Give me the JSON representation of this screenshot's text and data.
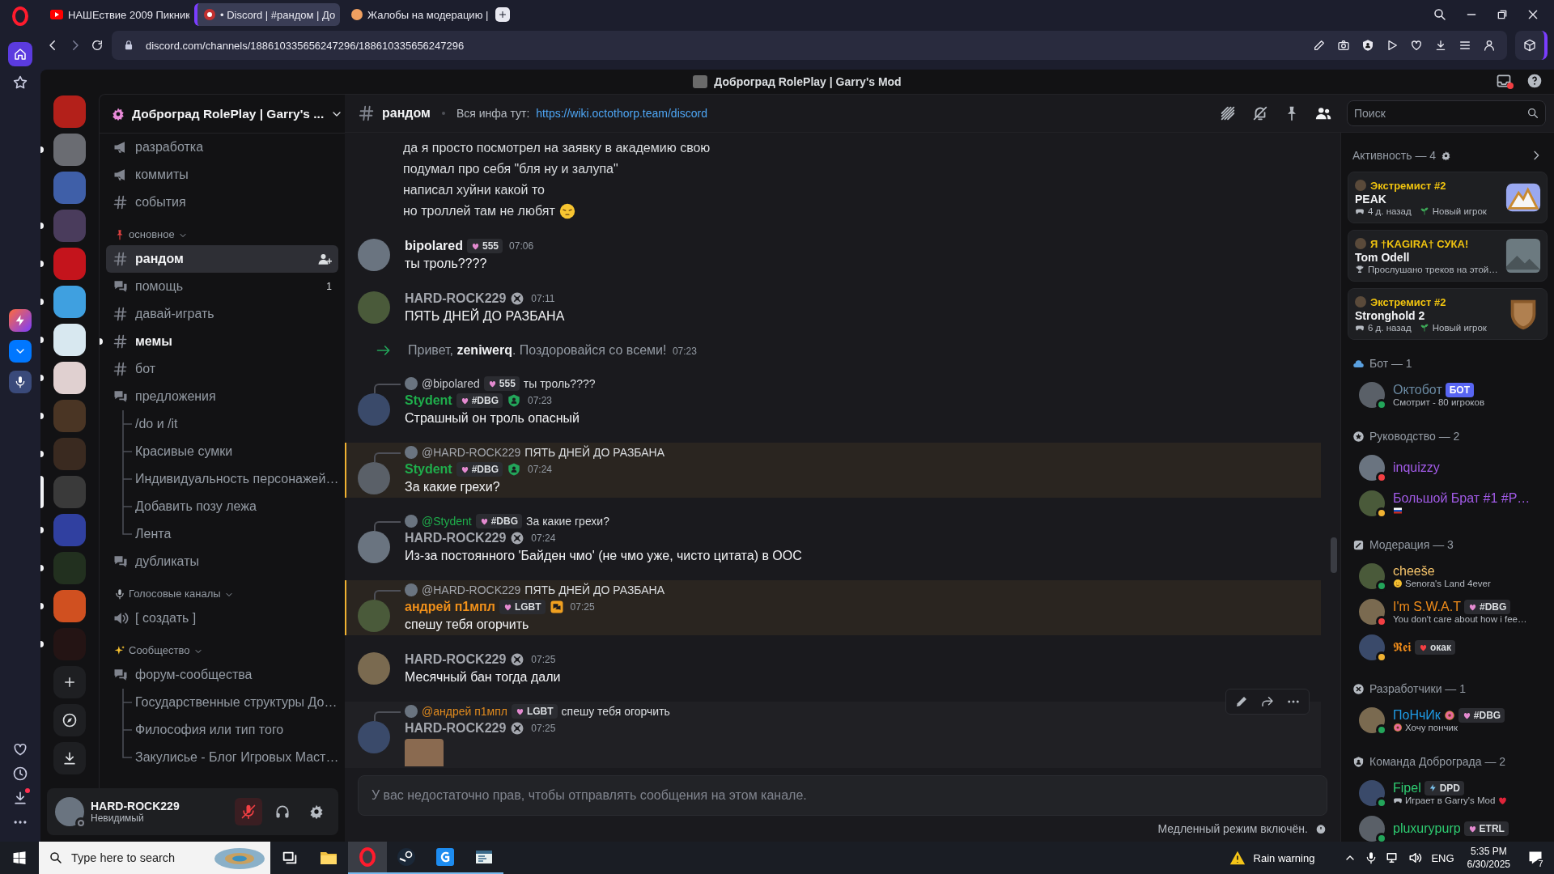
{
  "browser": {
    "tabs": [
      {
        "title": "НАШЕствие 2009 Пикник",
        "kind": "video",
        "selected": false
      },
      {
        "title": "• Discord | #рандом | До",
        "kind": "discord",
        "selected": true
      },
      {
        "title": "Жалобы на модерацию |",
        "kind": "forum",
        "selected": false
      }
    ],
    "url": "discord.com/channels/188610335656247296/188610335656247296"
  },
  "app_title": "Доброград RolePlay | Garry's Mod",
  "servers": [
    {
      "selected": false,
      "unread": false
    },
    {
      "selected": false,
      "unread": true
    },
    {
      "selected": false,
      "unread": false
    },
    {
      "selected": false,
      "unread": true
    },
    {
      "selected": false,
      "unread": true
    },
    {
      "selected": false,
      "unread": true
    },
    {
      "selected": false,
      "unread": true
    },
    {
      "selected": false,
      "unread": true
    },
    {
      "selected": false,
      "unread": true
    },
    {
      "selected": false,
      "unread": true
    },
    {
      "selected": true,
      "unread": true
    },
    {
      "selected": false,
      "unread": true
    },
    {
      "selected": false,
      "unread": true
    },
    {
      "selected": false,
      "unread": true
    },
    {
      "selected": false,
      "unread": true
    }
  ],
  "server_name": "Доброград RolePlay | Garry's ...",
  "channel_sections": [
    {
      "channels": [
        {
          "name": "разработка",
          "kind": "announcement",
          "selected": false,
          "unread": false
        },
        {
          "name": "коммиты",
          "kind": "announcement",
          "selected": false,
          "unread": false
        },
        {
          "name": "события",
          "kind": "text",
          "selected": false,
          "unread": false
        }
      ]
    },
    {
      "name": "основное",
      "kind": "pinned",
      "channels": [
        {
          "name": "рандом",
          "kind": "text",
          "selected": true,
          "unread": false
        },
        {
          "name": "помощь",
          "kind": "forum",
          "selected": false,
          "unread": false,
          "badge": "1"
        },
        {
          "name": "давай-играть",
          "kind": "text",
          "selected": false,
          "unread": false
        },
        {
          "name": "мемы",
          "kind": "text",
          "selected": false,
          "unread": true
        },
        {
          "name": "бот",
          "kind": "text",
          "selected": false,
          "unread": false
        },
        {
          "name": "предложения",
          "kind": "forum",
          "selected": false,
          "unread": false,
          "children": [
            {
              "name": "/do и /it"
            },
            {
              "name": "Красивые сумки"
            },
            {
              "name": "Индивидуальность персонажей…"
            },
            {
              "name": "Добавить позу лежа"
            },
            {
              "name": "Лента"
            }
          ]
        },
        {
          "name": "дубликаты",
          "kind": "forum",
          "selected": false,
          "unread": false
        }
      ]
    },
    {
      "name": "Голосовые каналы",
      "kind": "voice",
      "channels": [
        {
          "name": "[ создать ]",
          "kind": "voice",
          "selected": false,
          "unread": false
        }
      ]
    },
    {
      "name": "Сообщество",
      "kind": "community",
      "channels": [
        {
          "name": "форум-сообщества",
          "kind": "forum",
          "selected": false,
          "unread": false,
          "children": [
            {
              "name": "Государственные структуры До…"
            },
            {
              "name": "Философия или тип того"
            },
            {
              "name": "Закулисье - Блог Игровых Маст…"
            }
          ]
        }
      ]
    }
  ],
  "user_panel": {
    "name": "HARD-ROCK229",
    "status": "Невидимый",
    "muted": true
  },
  "chat": {
    "channel": "рандом",
    "topic": "Вся инфа тут:",
    "topic_link": "https://wiki.octothorp.team/discord",
    "search_placeholder": "Поиск",
    "messages": [
      {
        "kind": "continuation",
        "lines": [
          "да я просто посмотрел на заявку в академию свою",
          "подумал про себя \"бля ну и залупа\"",
          "написал хуйни какой то",
          "но троллей там не любят"
        ],
        "trailing_emoji": true
      },
      {
        "kind": "message",
        "author": "bipolared",
        "color": "#f2f3f5",
        "tag": {
          "text": "555",
          "kind": "heart"
        },
        "time": "07:06",
        "text": "ты троль????",
        "mentioned": false,
        "hovered": false
      },
      {
        "kind": "message",
        "author": "HARD-ROCK229",
        "color": "#a3a6ad",
        "role_badge": {
          "kind": "crossed"
        },
        "time": "07:11",
        "text": "ПЯТЬ ДНЕЙ ДО РАЗБАНА",
        "mentioned": false,
        "hovered": false
      },
      {
        "kind": "system",
        "text": "Привет, **zeniwerq**. Поздоровайся со всеми!",
        "time": "07:23"
      },
      {
        "kind": "message",
        "reply": {
          "author": "@bipolared",
          "color": "#c4c6cc",
          "tag": {
            "text": "555",
            "kind": "heart"
          },
          "text": "ты троль????"
        },
        "author": "Stydent",
        "color": "#1fae4c",
        "tag": {
          "text": "#DBG",
          "kind": "heart"
        },
        "role_badge": {
          "kind": "shield"
        },
        "time": "07:23",
        "text": "Страшный он троль опасный",
        "mentioned": false,
        "hovered": false
      },
      {
        "kind": "message",
        "reply": {
          "author": "@HARD-ROCK229",
          "color": "#a3a6ad",
          "text": "ПЯТЬ ДНЕЙ ДО РАЗБАНА"
        },
        "author": "Stydent",
        "color": "#1fae4c",
        "tag": {
          "text": "#DBG",
          "kind": "heart"
        },
        "role_badge": {
          "kind": "shield"
        },
        "time": "07:24",
        "text": "За какие грехи?",
        "mentioned": true,
        "hovered": false
      },
      {
        "kind": "message",
        "reply": {
          "author": "@Stydent",
          "color": "#1fae4c",
          "tag": {
            "text": "#DBG",
            "kind": "heart"
          },
          "text": "За какие грехи?"
        },
        "author": "HARD-ROCK229",
        "color": "#a3a6ad",
        "role_badge": {
          "kind": "crossed"
        },
        "time": "07:24",
        "text": "Из-за постоянного 'Байден чмо' (не чмо уже, чисто цитата) в ООС",
        "mentioned": false,
        "hovered": false
      },
      {
        "kind": "message",
        "reply": {
          "author": "@HARD-ROCK229",
          "color": "#a3a6ad",
          "text": "ПЯТЬ ДНЕЙ ДО РАЗБАНА"
        },
        "author": "андрей п1мпл",
        "color": "#f0901a",
        "tag": {
          "text": "LGBT",
          "kind": "heart"
        },
        "role_badge": {
          "kind": "chat"
        },
        "time": "07:25",
        "text": "спешу тебя огорчить",
        "mentioned": true,
        "hovered": false
      },
      {
        "kind": "message",
        "author": "HARD-ROCK229",
        "color": "#a3a6ad",
        "role_badge": {
          "kind": "crossed"
        },
        "time": "07:25",
        "text": "Месячный бан тогда дали",
        "mentioned": false,
        "hovered": false
      },
      {
        "kind": "message",
        "reply": {
          "author": "@андрей п1мпл",
          "color": "#e08a1e",
          "tag": {
            "text": "LGBT",
            "kind": "heart"
          },
          "text": "спешу тебя огорчить"
        },
        "author": "HARD-ROCK229",
        "color": "#a3a6ad",
        "role_badge": {
          "kind": "crossed"
        },
        "time": "07:25",
        "attachment": {
          "kind": "image"
        },
        "mentioned": false,
        "hovered": true
      }
    ],
    "input_placeholder": "У вас недостаточно прав, чтобы отправлять сообщения на этом канале.",
    "slowmode": "Медленный режим включён."
  },
  "members": {
    "activity_title": "Активность — 4",
    "activities": [
      {
        "user": "Экстремист #2",
        "color": "#f1c40f",
        "title": "PEAK",
        "kind": "game",
        "time": "4 д. назад",
        "tag": "Новый игрок"
      },
      {
        "user": "Я †KAGIRA† СУКА!",
        "color": "#f1c40f",
        "title": "Tom Odell",
        "kind": "music",
        "detail": "Прослушано треков на этой…"
      },
      {
        "user": "Экстремист #2",
        "color": "#f1c40f",
        "title": "Stronghold 2",
        "kind": "game",
        "time": "6 д. назад",
        "tag": "Новый игрок"
      }
    ],
    "groups": [
      {
        "title": "Бот — 1",
        "kind": "bot",
        "members": [
          {
            "name": "Октобот",
            "color": "#6b8ba4",
            "presence": {
              "kind": "online"
            },
            "tag": {
              "text": "БОТ",
              "kind": "bot"
            },
            "sub": "Смотрит - 80 игроков"
          }
        ]
      },
      {
        "title": "Руководство — 2",
        "kind": "star",
        "members": [
          {
            "name": "inquizzy",
            "color": "#a25be8",
            "presence": {
              "kind": "dnd"
            }
          },
          {
            "name": "Большой Брат #1 #P…",
            "color": "#a25be8",
            "presence": {
              "kind": "idle"
            },
            "sub_icon": {
              "kind": "flag"
            }
          }
        ]
      },
      {
        "title": "Модерация — 3",
        "kind": "mod",
        "members": [
          {
            "name": "cheeše",
            "color": "#f5c46b",
            "presence": {
              "kind": "online"
            },
            "sub": "Senora's Land 4ever",
            "sub_icon": {
              "kind": "emoji"
            }
          },
          {
            "name": "I'm S.W.A.T",
            "color": "#f08c1a",
            "presence": {
              "kind": "dnd"
            },
            "tag": {
              "text": "#DBG",
              "kind": "heart"
            },
            "sub": "You don't care about how i fee…"
          },
          {
            "name": "𝕽𝖊𝖎",
            "color": "#f08c1a",
            "presence": {
              "kind": "idle"
            },
            "tag": {
              "text": "окак",
              "kind": "redheart"
            }
          }
        ]
      },
      {
        "title": "Разработчики — 1",
        "kind": "dev",
        "members": [
          {
            "name": "ПоНчИк",
            "color": "#1f9be6",
            "presence": {
              "kind": "online"
            },
            "name_icon": {
              "kind": "donut"
            },
            "tag": {
              "text": "#DBG",
              "kind": "heart"
            },
            "sub": "Хочу пончик",
            "sub_icon": {
              "kind": "donut"
            }
          }
        ]
      },
      {
        "title": "Команда Доброграда — 2",
        "kind": "team",
        "members": [
          {
            "name": "Fipel",
            "color": "#2ecc71",
            "presence": {
              "kind": "online"
            },
            "tag": {
              "text": "DPD",
              "kind": "bolt"
            },
            "sub": "Играет в Garry's Mod",
            "sub_icon": {
              "kind": "gamepad"
            },
            "sub_end": {
              "kind": "heart"
            }
          },
          {
            "name": "pluxurypurp",
            "color": "#2ecc71",
            "presence": {
              "kind": "online"
            },
            "tag": {
              "text": "ETRL",
              "kind": "heart"
            }
          }
        ]
      }
    ]
  },
  "taskbar": {
    "search_placeholder": "Type here to search",
    "apps": [
      {
        "kind": "explorer",
        "selected": false,
        "running": false
      },
      {
        "kind": "opera",
        "selected": true,
        "running": true
      },
      {
        "kind": "steam",
        "selected": false,
        "running": true
      },
      {
        "kind": "gmod",
        "selected": false,
        "running": true
      },
      {
        "kind": "terminal",
        "selected": false,
        "running": true
      }
    ],
    "weather": "Rain warning",
    "language": "ENG",
    "time": "5:35 PM",
    "date": "6/30/2025",
    "notifications": "7"
  }
}
